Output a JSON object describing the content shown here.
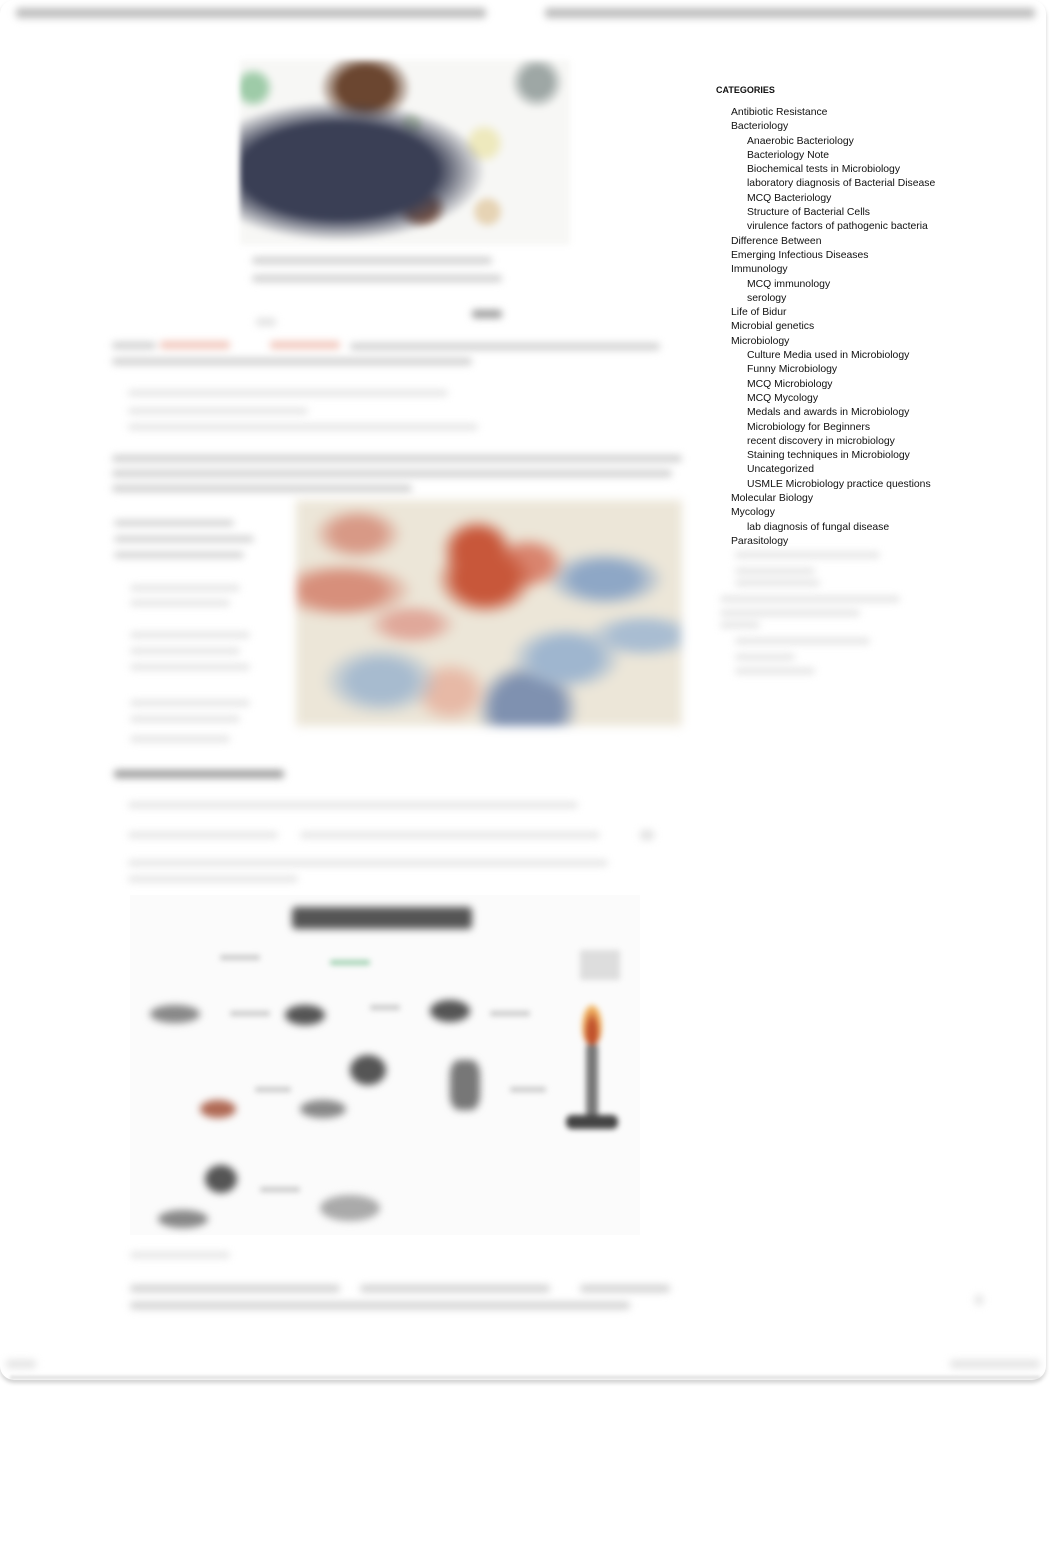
{
  "page": {
    "header_text_blurred": true,
    "main_content_blurred": true
  },
  "sidebar": {
    "title": "CATEGORIES",
    "items": [
      {
        "label": "Antibiotic Resistance",
        "level": 1
      },
      {
        "label": "Bacteriology",
        "level": 1
      },
      {
        "label": "Anaerobic Bacteriology",
        "level": 2
      },
      {
        "label": "Bacteriology Note",
        "level": 2
      },
      {
        "label": "Biochemical tests in Microbiology",
        "level": 2
      },
      {
        "label": "laboratory diagnosis of Bacterial Disease",
        "level": 2
      },
      {
        "label": "MCQ Bacteriology",
        "level": 2
      },
      {
        "label": "Structure of Bacterial Cells",
        "level": 2
      },
      {
        "label": "virulence factors of pathogenic bacteria",
        "level": 2
      },
      {
        "label": "Difference Between",
        "level": 1
      },
      {
        "label": "Emerging Infectious Diseases",
        "level": 1
      },
      {
        "label": "Immunology",
        "level": 1
      },
      {
        "label": "MCQ immunology",
        "level": 2
      },
      {
        "label": "serology",
        "level": 2
      },
      {
        "label": "Life of Bidur",
        "level": 1
      },
      {
        "label": "Microbial genetics",
        "level": 1
      },
      {
        "label": "Microbiology",
        "level": 1
      },
      {
        "label": "Culture Media used in Microbiology",
        "level": 2
      },
      {
        "label": "Funny Microbiology",
        "level": 2
      },
      {
        "label": "MCQ Microbiology",
        "level": 2
      },
      {
        "label": "MCQ Mycology",
        "level": 2
      },
      {
        "label": "Medals and awards in Microbiology",
        "level": 2
      },
      {
        "label": "Microbiology for Beginners",
        "level": 2
      },
      {
        "label": "recent discovery in microbiology",
        "level": 2
      },
      {
        "label": "Staining techniques in Microbiology",
        "level": 2
      },
      {
        "label": "Uncategorized",
        "level": 2
      },
      {
        "label": "USMLE Microbiology practice questions",
        "level": 2
      },
      {
        "label": "Molecular Biology",
        "level": 1
      },
      {
        "label": "Mycology",
        "level": 1
      },
      {
        "label": "lab diagnosis of fungal disease",
        "level": 2
      },
      {
        "label": "Parasitology",
        "level": 1
      }
    ]
  },
  "colors": {
    "link_accent": "#f2c8bd",
    "stain_red": "#c8573a",
    "stain_blue": "#8ea7c6"
  }
}
